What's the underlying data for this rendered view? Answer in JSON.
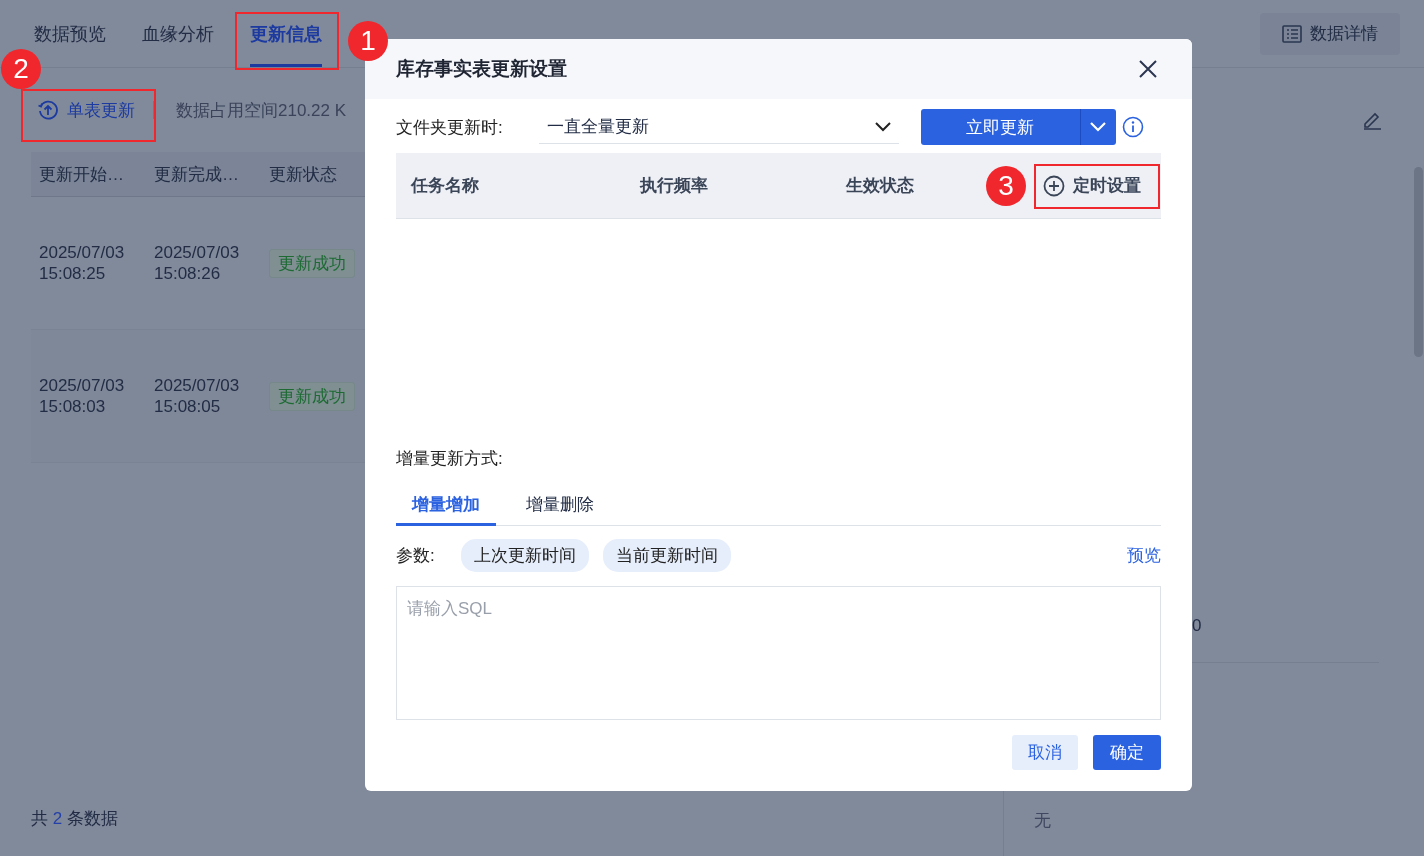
{
  "page_tabs": [
    {
      "label": "数据预览",
      "selected": false
    },
    {
      "label": "血缘分析",
      "selected": false
    },
    {
      "label": "更新信息",
      "selected": true
    }
  ],
  "details_button": "数据详情",
  "toolbar": {
    "update_button": "单表更新",
    "storage_info": "数据占用空间210.22 K"
  },
  "table": {
    "columns": [
      "更新开始…",
      "更新完成…",
      "更新状态"
    ],
    "rows": [
      {
        "start_date": "2025/07/03",
        "start_time": "15:08:25",
        "end_date": "2025/07/03",
        "end_time": "15:08:26",
        "status": {
          "label": "更新成功",
          "kind": "success"
        }
      },
      {
        "start_date": "2025/07/03",
        "start_time": "15:08:03",
        "end_date": "2025/07/03",
        "end_time": "15:08:05",
        "status": {
          "label": "更新成功",
          "kind": "success"
        }
      }
    ]
  },
  "footer": {
    "prefix": "共",
    "count": "2",
    "suffix": "条数据"
  },
  "side_panel": {
    "value": "0",
    "extra_value": "无"
  },
  "dialog": {
    "title": "库存事实表更新设置",
    "folder_update_label": "文件夹更新时:",
    "folder_update_value": "一直全量更新",
    "update_button": "立即更新",
    "task_columns": [
      "任务名称",
      "执行频率",
      "生效状态"
    ],
    "schedule_button": "定时设置",
    "incremental_label": "增量更新方式:",
    "tabs": [
      {
        "label": "增量增加",
        "selected": true
      },
      {
        "label": "增量删除",
        "selected": false
      }
    ],
    "params_label": "参数:",
    "params": [
      "上次更新时间",
      "当前更新时间"
    ],
    "preview_link": "预览",
    "sql_placeholder": "请输入SQL",
    "cancel_button": "取消",
    "confirm_button": "确定"
  },
  "annotations": [
    {
      "number": "1"
    },
    {
      "number": "2"
    },
    {
      "number": "3"
    }
  ]
}
